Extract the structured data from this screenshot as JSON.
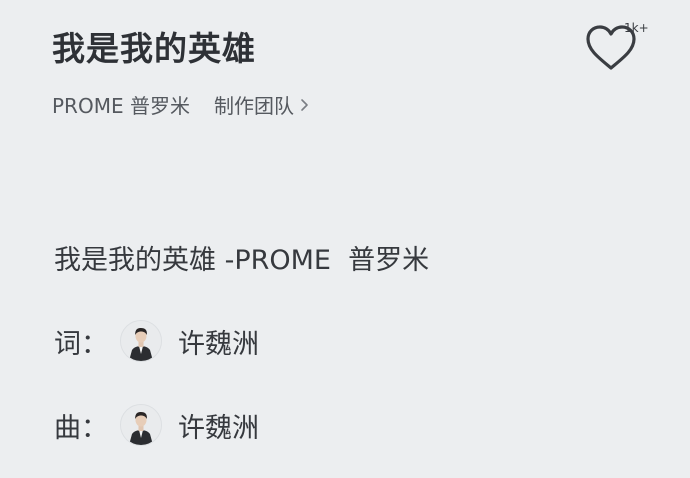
{
  "header": {
    "title": "我是我的英雄",
    "like_count": "1k+"
  },
  "meta": {
    "artist": "PROME 普罗米",
    "team_label": "制作团队"
  },
  "lyrics": {
    "first_line": "我是我的英雄 -PROME  普罗米"
  },
  "credits": {
    "lyricist_label": "词：",
    "lyricist_name": "许魏洲",
    "composer_label": "曲：",
    "composer_name": "许魏洲"
  },
  "icons": {
    "like": "heart-outline-icon",
    "team_more": "chevron-right-icon"
  }
}
